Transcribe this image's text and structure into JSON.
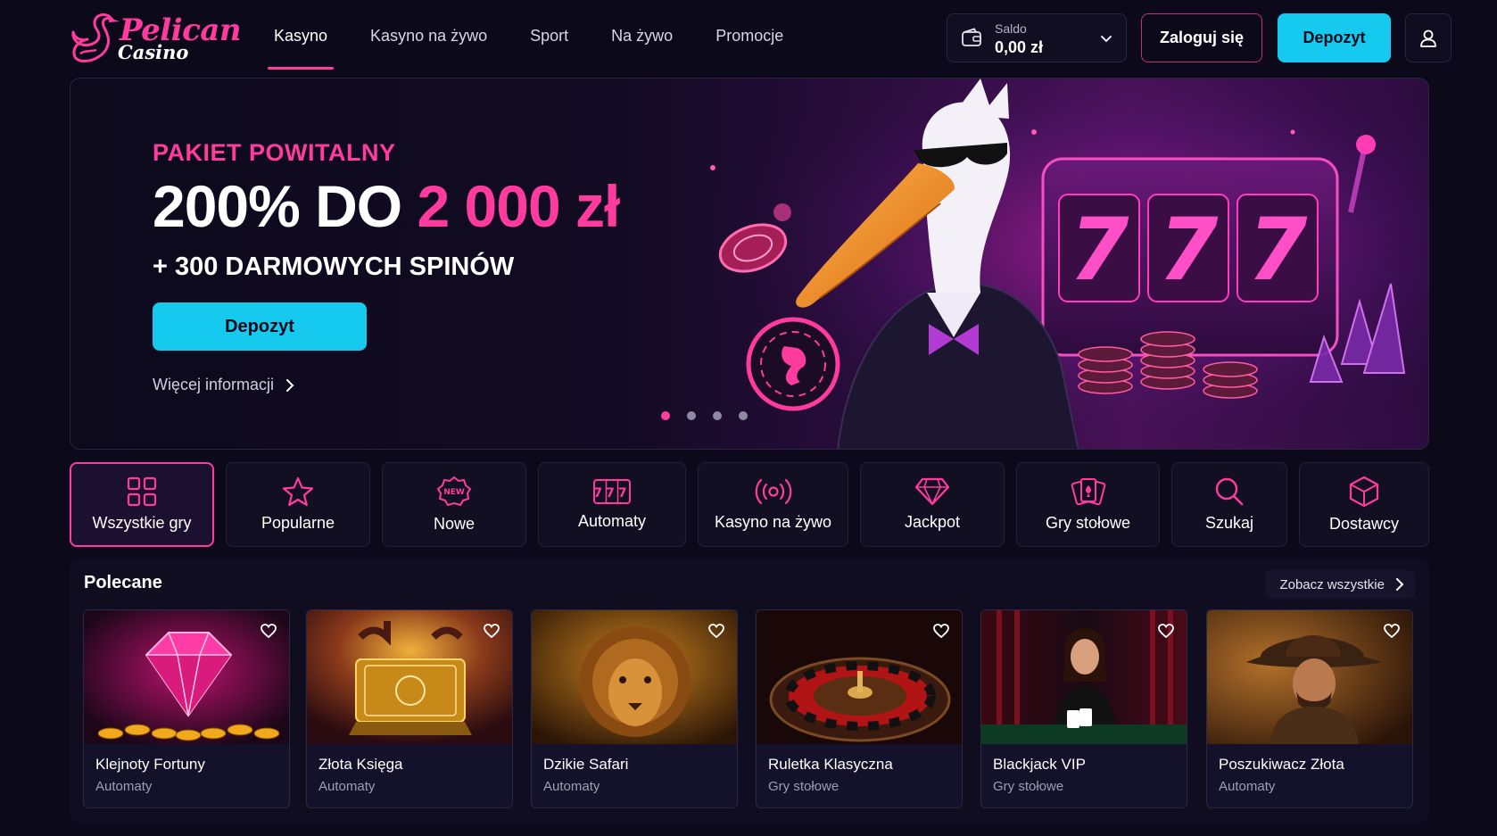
{
  "brand": {
    "line1": "Pelican",
    "line2": "Casino"
  },
  "nav": [
    {
      "label": "Kasyno",
      "active": true
    },
    {
      "label": "Kasyno na żywo"
    },
    {
      "label": "Sport"
    },
    {
      "label": "Na żywo"
    },
    {
      "label": "Promocje"
    }
  ],
  "balance": {
    "label": "Saldo",
    "value": "0,00 zł"
  },
  "header_actions": {
    "login": "Zaloguj się",
    "deposit": "Depozyt"
  },
  "hero": {
    "tag": "PAKIET POWITALNY",
    "headline_main": "200% DO ",
    "headline_accent": "2 000 zł",
    "subline": "+ 300 DARMOWYCH SPINÓW",
    "cta": "Depozyt",
    "more": "Więcej informacji",
    "slot_digits": [
      "7",
      "7",
      "7"
    ],
    "slides": 4,
    "active_slide": 1
  },
  "categories": [
    {
      "label": "Wszystkie gry",
      "icon": "grid-icon",
      "active": true
    },
    {
      "label": "Popularne",
      "icon": "star-icon"
    },
    {
      "label": "Nowe",
      "icon": "new-badge-icon",
      "badge": "NEW"
    },
    {
      "label": "Automaty",
      "icon": "slot-machine-icon",
      "badge": "777"
    },
    {
      "label": "Kasyno na żywo",
      "icon": "broadcast-icon"
    },
    {
      "label": "Jackpot",
      "icon": "diamond-icon"
    },
    {
      "label": "Gry stołowe",
      "icon": "cards-icon"
    },
    {
      "label": "Szukaj",
      "icon": "search-icon"
    },
    {
      "label": "Dostawcy",
      "icon": "box-icon"
    }
  ],
  "featured": {
    "title": "Polecane",
    "see_all": "Zobacz wszystkie",
    "games": [
      {
        "name": "Klejnoty Fortuny",
        "category": "Automaty"
      },
      {
        "name": "Złota Księga",
        "category": "Automaty"
      },
      {
        "name": "Dzikie Safari",
        "category": "Automaty"
      },
      {
        "name": "Ruletka Klasyczna",
        "category": "Gry stołowe"
      },
      {
        "name": "Blackjack VIP",
        "category": "Gry stołowe"
      },
      {
        "name": "Poszukiwacz Złota",
        "category": "Automaty"
      }
    ]
  },
  "colors": {
    "accent_pink": "#ff3c9e",
    "accent_cyan": "#16c9ef",
    "background": "#0c0a1a"
  }
}
